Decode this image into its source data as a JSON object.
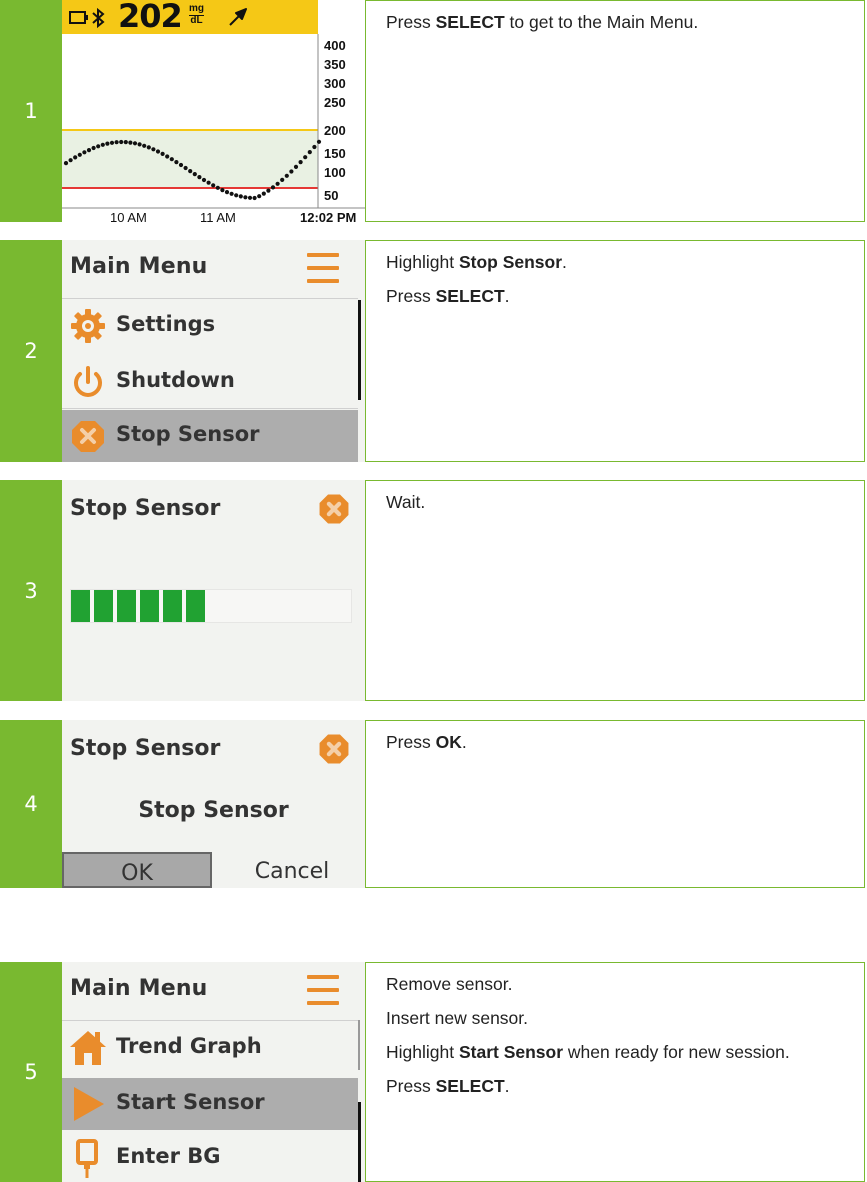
{
  "steps": [
    {
      "number": "1",
      "screen": {
        "glucose_value": "202",
        "glucose_unit_top": "mg",
        "glucose_unit_bottom": "dL",
        "y_ticks": [
          "400",
          "350",
          "300",
          "250",
          "200",
          "150",
          "100",
          "50"
        ],
        "x_ticks": [
          "10 AM",
          "11 AM",
          "12:02 PM"
        ],
        "high_line_color": "#f5c816",
        "low_line_color": "#e53935"
      },
      "instructions": [
        {
          "before": "Press ",
          "bold": "SELECT",
          "after": " to get to the Main Menu."
        }
      ]
    },
    {
      "number": "2",
      "screen": {
        "title": "Main Menu",
        "items": [
          {
            "label": "Settings",
            "icon": "gear-icon"
          },
          {
            "label": "Shutdown",
            "icon": "power-icon"
          },
          {
            "label": "Stop Sensor",
            "icon": "stop-sensor-icon",
            "selected": true
          }
        ]
      },
      "instructions": [
        {
          "before": "Highlight ",
          "bold": "Stop Sensor",
          "after": "."
        },
        {
          "before": "Press ",
          "bold": "SELECT",
          "after": "."
        }
      ]
    },
    {
      "number": "3",
      "screen": {
        "title": "Stop Sensor",
        "progress_fraction": 0.5
      },
      "instructions": [
        {
          "before": "Wait.",
          "bold": "",
          "after": ""
        }
      ]
    },
    {
      "number": "4",
      "screen": {
        "title": "Stop Sensor",
        "message": "Stop Sensor",
        "ok_label": "OK",
        "cancel_label": "Cancel"
      },
      "instructions": [
        {
          "before": "Press ",
          "bold": "OK",
          "after": "."
        }
      ]
    },
    {
      "number": "5",
      "screen": {
        "title": "Main Menu",
        "items": [
          {
            "label": "Trend Graph",
            "icon": "home-icon"
          },
          {
            "label": "Start Sensor",
            "icon": "play-icon",
            "selected": true
          },
          {
            "label": "Enter BG",
            "icon": "blood-drop-icon"
          }
        ]
      },
      "instructions": [
        {
          "before": "Remove sensor.",
          "bold": "",
          "after": ""
        },
        {
          "before": "Insert new sensor.",
          "bold": "",
          "after": ""
        },
        {
          "before": "Highlight ",
          "bold": "Start Sensor",
          "after": " when ready for new session."
        },
        {
          "before": "Press ",
          "bold": "SELECT",
          "after": "."
        }
      ]
    }
  ]
}
